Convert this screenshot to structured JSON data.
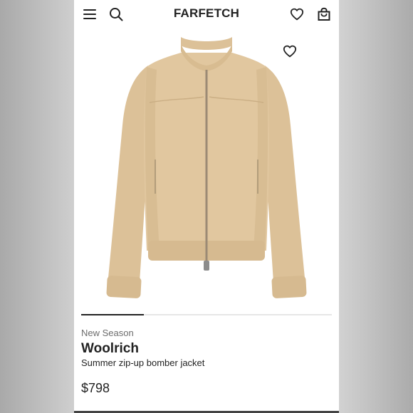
{
  "header": {
    "brand": "FARFETCH",
    "icons": [
      "menu-icon",
      "search-icon",
      "heart-icon",
      "bag-icon"
    ]
  },
  "product": {
    "season": "New Season",
    "designer": "Woolrich",
    "description": "Summer zip-up bomber jacket",
    "price": "$798",
    "image_progress": 0.25
  },
  "colors": {
    "accent": "#222222",
    "muted": "#6c6c6c",
    "jacket": "#ddc299"
  }
}
